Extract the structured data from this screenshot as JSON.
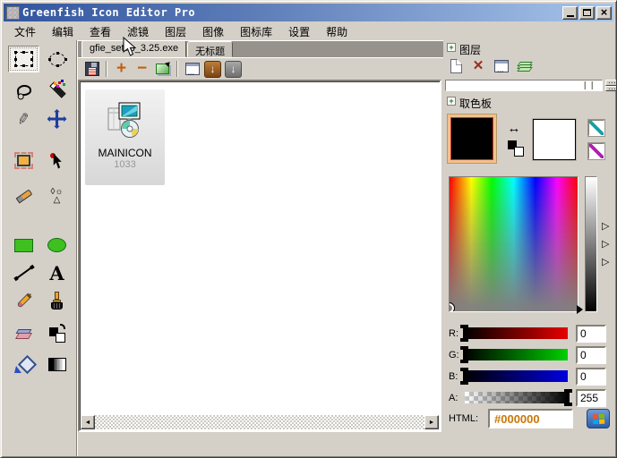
{
  "window": {
    "title": "Greenfish Icon Editor Pro"
  },
  "menu": {
    "items": [
      "文件",
      "编辑",
      "查看",
      "滤镜",
      "图层",
      "图像",
      "图标库",
      "设置",
      "帮助"
    ]
  },
  "tabs": [
    {
      "label": "gfie_setup_3.25.exe",
      "active": true
    },
    {
      "label": "无标题",
      "active": false
    }
  ],
  "document_toolbar": {
    "icons": [
      "save-icon",
      "add-page-icon",
      "remove-page-icon",
      "convert-icon",
      "window-icon",
      "import-arrow-icon",
      "export-arrow-icon"
    ]
  },
  "tools": {
    "selected": "rectangle-select",
    "icons": [
      "rectangle-select-icon",
      "ellipse-select-icon",
      "lasso-icon",
      "magic-wand-icon",
      "pen-icon",
      "move-icon",
      "crop-icon",
      "hotspot-icon",
      "eyedropper-icon",
      "retouch-icon",
      "filled-rectangle-icon",
      "filled-ellipse-icon",
      "line-icon",
      "text-icon",
      "pencil-icon",
      "brush-icon",
      "eraser-icon",
      "swap-colors-icon",
      "fill-icon",
      "gradient-icon"
    ]
  },
  "canvas": {
    "item": {
      "name": "MAINICON",
      "id": "1033"
    }
  },
  "layers_panel": {
    "title": "图层",
    "icons": [
      "new-layer-icon",
      "delete-layer-icon",
      "layer-properties-icon",
      "layers-stack-icon"
    ]
  },
  "color_panel": {
    "title": "取色板",
    "foreground_color": "#000000",
    "background_color": "#FFFFFF",
    "sliders": [
      {
        "label": "R:",
        "value": "0"
      },
      {
        "label": "G:",
        "value": "0"
      },
      {
        "label": "B:",
        "value": "0"
      },
      {
        "label": "A:",
        "value": "255"
      }
    ],
    "html_label": "HTML:",
    "html_value": "#000000"
  },
  "glyphs": {
    "close": "×",
    "plus": "+",
    "minus": "−",
    "arrow_down": "↓",
    "scroll_left": "◄",
    "scroll_right": "►",
    "swap": "↔",
    "marker": "▷",
    "delete": "✕",
    "expand": "+",
    "text_tool": "A",
    "pen_tool": "✎",
    "retouch_top": "◊☼",
    "retouch_bottom": "△"
  },
  "colors": {
    "chrome": "#d4d0c8",
    "titlebar_left": "#31549f",
    "titlebar_right": "#a7c4ea",
    "accent_orange": "#c06010",
    "html_text": "#c87808",
    "selection_border": "#c03a28"
  }
}
